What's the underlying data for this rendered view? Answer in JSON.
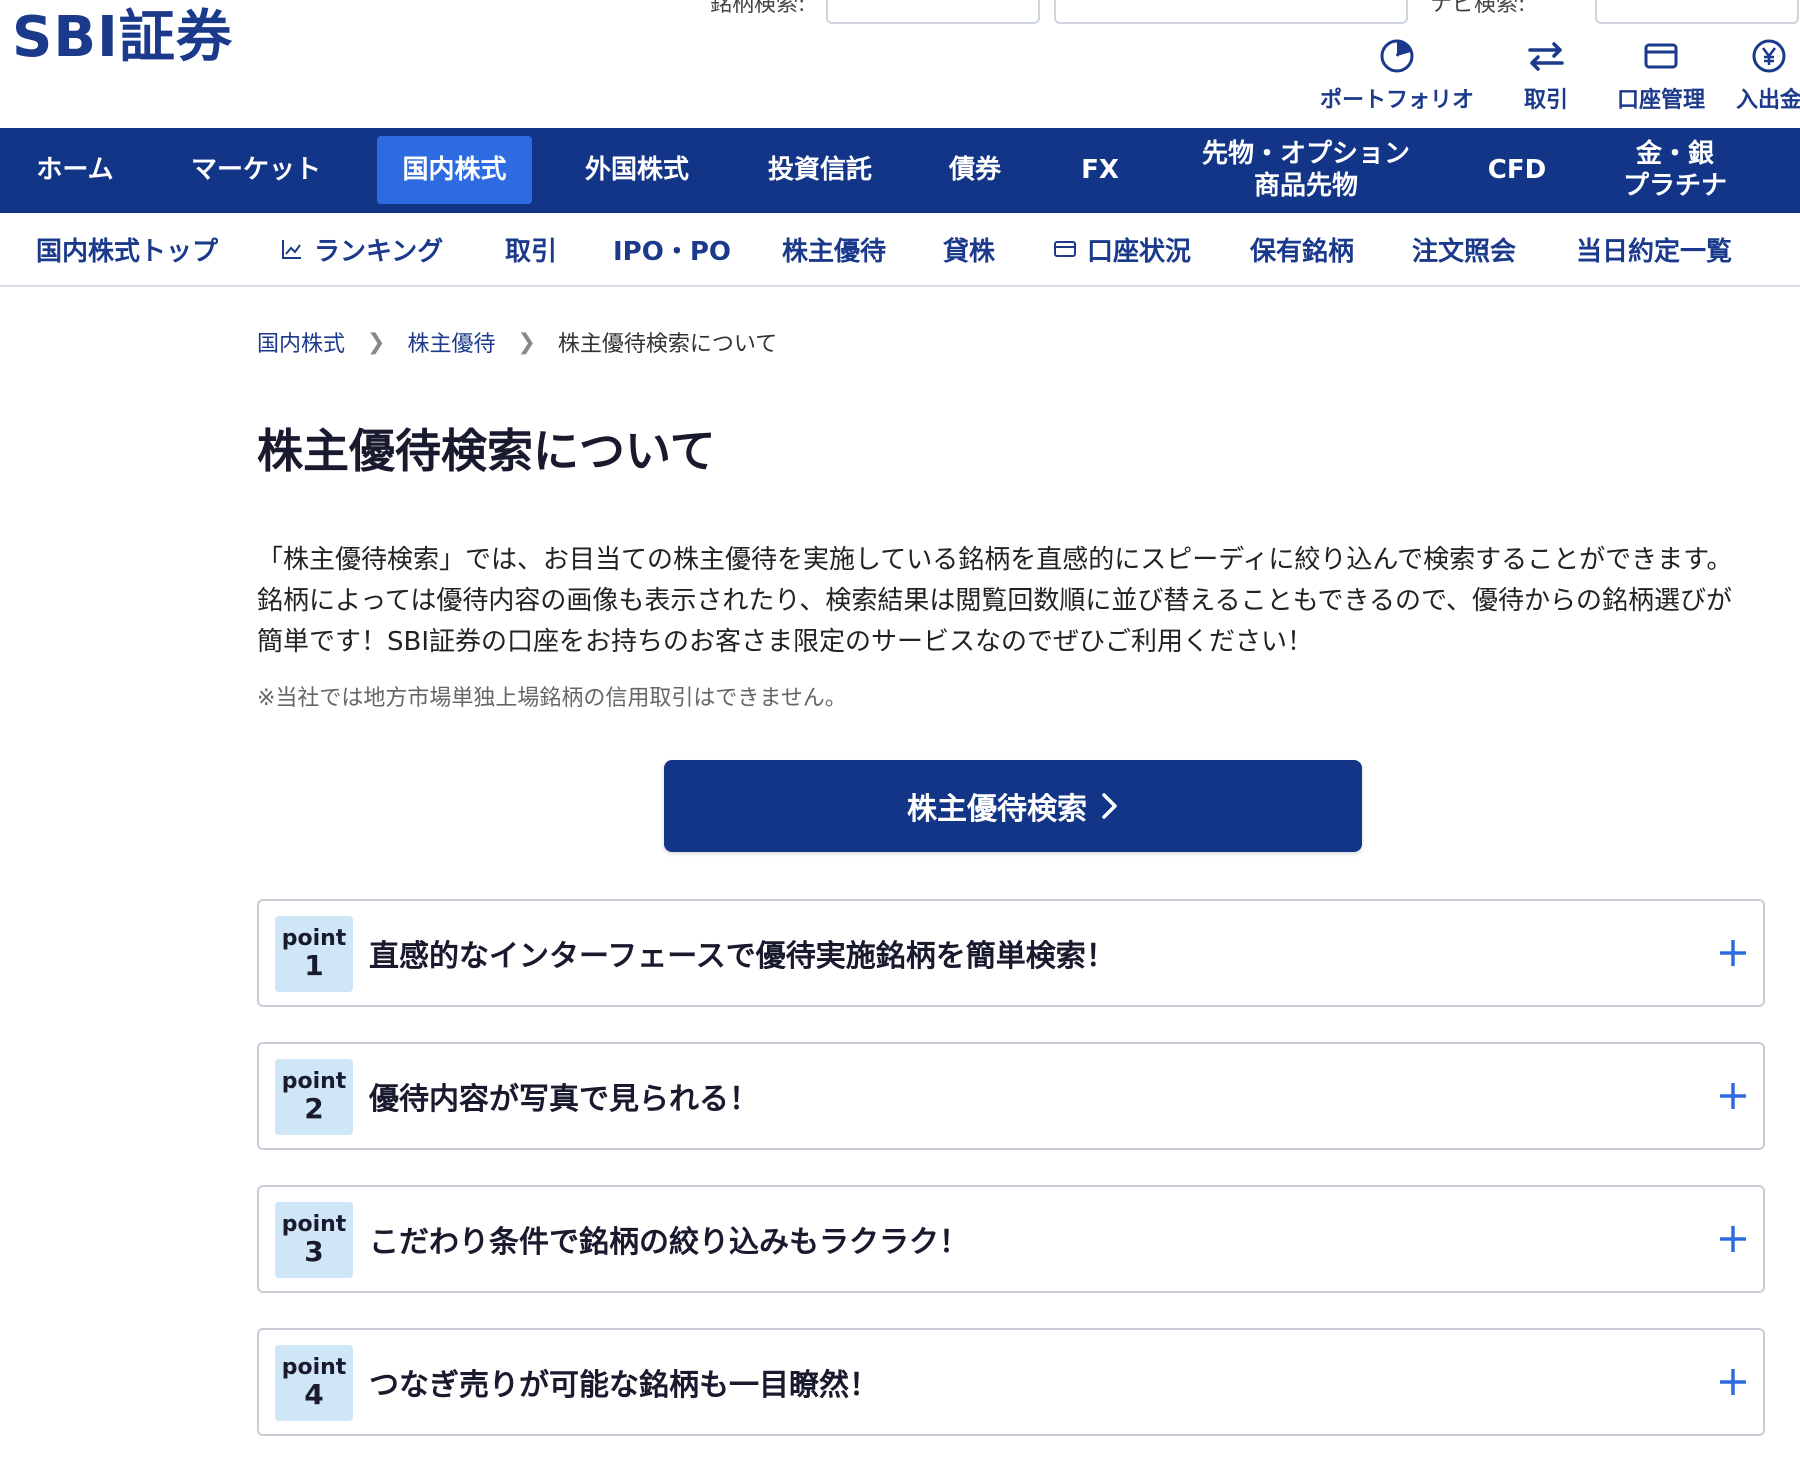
{
  "header": {
    "logo": "SBI証券",
    "search_labels": [
      "銘柄検索:",
      "ナビ検索:"
    ],
    "quick_links": [
      {
        "label": "ポートフォリオ",
        "icon": "pie-chart-icon"
      },
      {
        "label": "取引",
        "icon": "exchange-arrows-icon"
      },
      {
        "label": "口座管理",
        "icon": "card-icon"
      },
      {
        "label": "入出金",
        "icon": "yen-coin-icon"
      }
    ]
  },
  "main_nav": [
    {
      "label": "ホーム"
    },
    {
      "label": "マーケット"
    },
    {
      "label": "国内株式",
      "active": true
    },
    {
      "label": "外国株式"
    },
    {
      "label": "投資信託"
    },
    {
      "label": "債券"
    },
    {
      "label": "FX"
    },
    {
      "label": "先物・オプション\n商品先物"
    },
    {
      "label": "CFD"
    },
    {
      "label": "金・銀\nプラチナ"
    }
  ],
  "sub_nav": [
    {
      "label": "国内株式トップ"
    },
    {
      "label": "ランキング",
      "icon": "chart-line-icon"
    },
    {
      "label": "取引"
    },
    {
      "label": "IPO・PO"
    },
    {
      "label": "株主優待"
    },
    {
      "label": "貸株"
    },
    {
      "label": "口座状況",
      "icon": "card-icon"
    },
    {
      "label": "保有銘柄"
    },
    {
      "label": "注文照会"
    },
    {
      "label": "当日約定一覧"
    }
  ],
  "breadcrumb": [
    "国内株式",
    "株主優待",
    "株主優待検索について"
  ],
  "page_title": "株主優待検索について",
  "intro": "「株主優待検索」では、お目当ての株主優待を実施している銘柄を直感的にスピーディに絞り込んで検索することができます。銘柄によっては優待内容の画像も表示されたり、検索結果は閲覧回数順に並び替えることもできるので、優待からの銘柄選びが簡単です！SBI証券の口座をお持ちのお客さま限定のサービスなのでぜひご利用ください！",
  "note": "※当社では地方市場単独上場銘柄の信用取引はできません。",
  "cta_label": "株主優待検索",
  "points": [
    {
      "word": "point",
      "num": "1",
      "title": "直感的なインターフェースで優待実施銘柄を簡単検索！"
    },
    {
      "word": "point",
      "num": "2",
      "title": "優待内容が写真で見られる！"
    },
    {
      "word": "point",
      "num": "3",
      "title": "こだわり条件で銘柄の絞り込みもラクラク！"
    },
    {
      "word": "point",
      "num": "4",
      "title": "つなぎ売りが可能な銘柄も一目瞭然！"
    }
  ],
  "colors": {
    "navy": "#133587",
    "active_tab": "#2f6be0",
    "badge": "#cfe6f7",
    "link": "#1b3a8c"
  }
}
